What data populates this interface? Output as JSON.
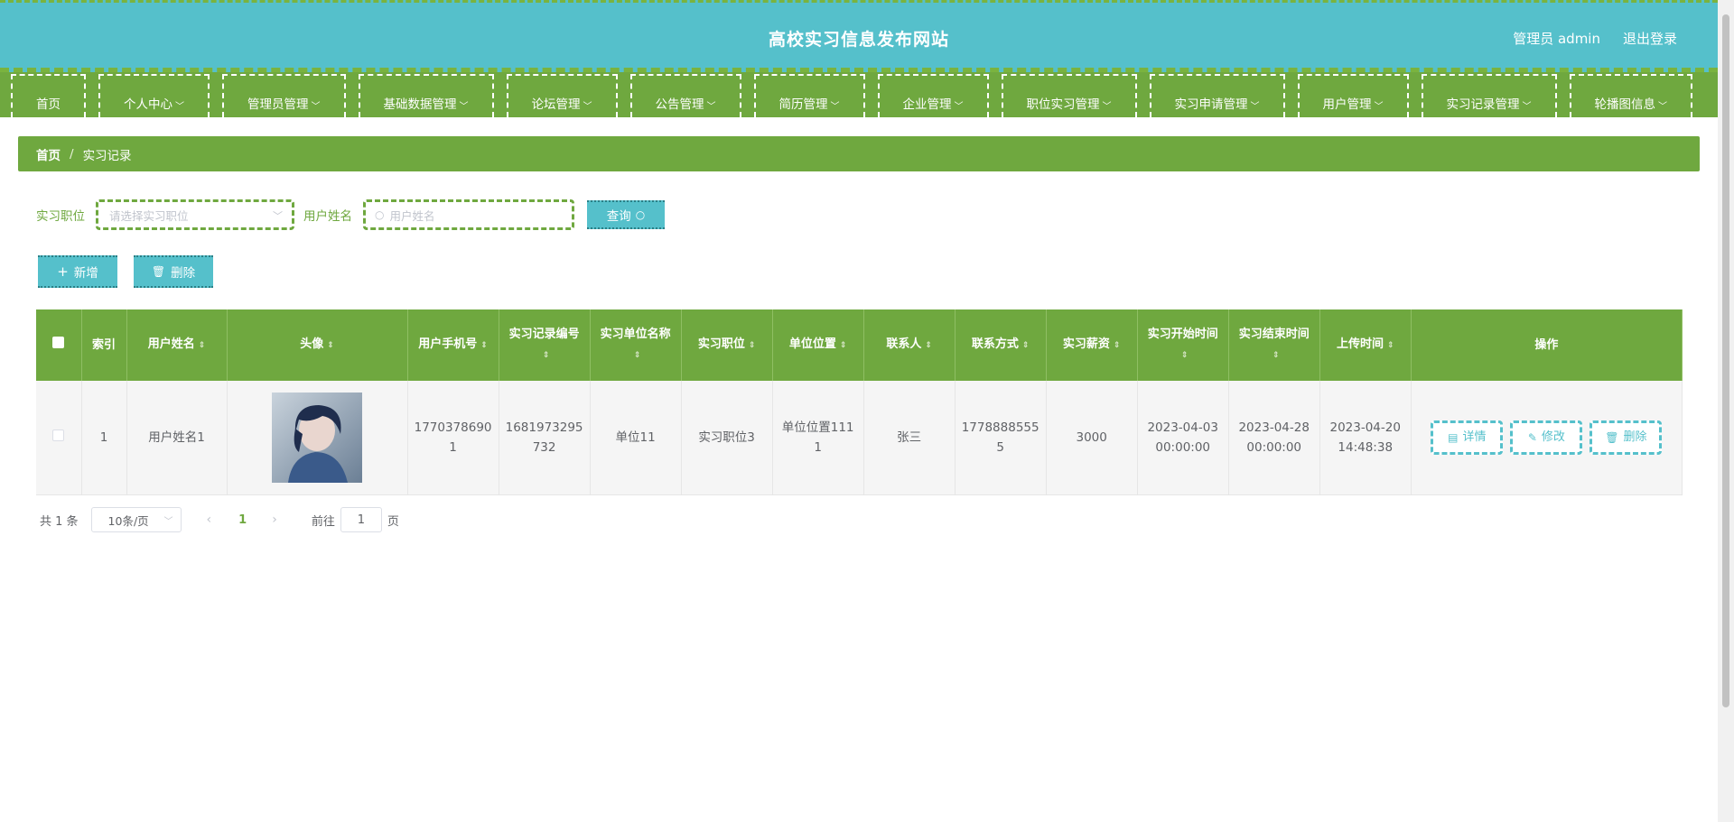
{
  "header": {
    "title": "高校实习信息发布网站",
    "user": "管理员 admin",
    "logout": "退出登录"
  },
  "nav": [
    {
      "label": "首页",
      "dropdown": false
    },
    {
      "label": "个人中心",
      "dropdown": true
    },
    {
      "label": "管理员管理",
      "dropdown": true
    },
    {
      "label": "基础数据管理",
      "dropdown": true
    },
    {
      "label": "论坛管理",
      "dropdown": true
    },
    {
      "label": "公告管理",
      "dropdown": true
    },
    {
      "label": "简历管理",
      "dropdown": true
    },
    {
      "label": "企业管理",
      "dropdown": true
    },
    {
      "label": "职位实习管理",
      "dropdown": true
    },
    {
      "label": "实习申请管理",
      "dropdown": true
    },
    {
      "label": "用户管理",
      "dropdown": true
    },
    {
      "label": "实习记录管理",
      "dropdown": true
    },
    {
      "label": "轮播图信息",
      "dropdown": true
    }
  ],
  "breadcrumb": {
    "home": "首页",
    "sep": "/",
    "current": "实习记录"
  },
  "search": {
    "position_label": "实习职位",
    "position_placeholder": "请选择实习职位",
    "username_label": "用户姓名",
    "username_placeholder": "用户姓名",
    "query_label": "查询"
  },
  "actions": {
    "add": "新增",
    "delete": "删除"
  },
  "table": {
    "columns": [
      {
        "label": "",
        "sortable": false
      },
      {
        "label": "索引",
        "sortable": false
      },
      {
        "label": "用户姓名",
        "sortable": true
      },
      {
        "label": "头像",
        "sortable": true
      },
      {
        "label": "用户手机号",
        "sortable": true
      },
      {
        "label": "实习记录编号",
        "sortable": true
      },
      {
        "label": "实习单位名称",
        "sortable": true
      },
      {
        "label": "实习职位",
        "sortable": true
      },
      {
        "label": "单位位置",
        "sortable": true
      },
      {
        "label": "联系人",
        "sortable": true
      },
      {
        "label": "联系方式",
        "sortable": true
      },
      {
        "label": "实习薪资",
        "sortable": true
      },
      {
        "label": "实习开始时间",
        "sortable": true
      },
      {
        "label": "实习结束时间",
        "sortable": true
      },
      {
        "label": "上传时间",
        "sortable": true
      },
      {
        "label": "操作",
        "sortable": false
      }
    ],
    "rows": [
      {
        "index": "1",
        "username": "用户姓名1",
        "phone": "17703786901",
        "record_no": "1681973295732",
        "company": "单位11",
        "position": "实习职位3",
        "location": "单位位置1111",
        "contact": "张三",
        "contact_phone": "17788885555",
        "salary": "3000",
        "start": "2023-04-03 00:00:00",
        "end": "2023-04-28 00:00:00",
        "uploaded": "2023-04-20 14:48:38"
      }
    ],
    "row_ops": {
      "detail": "详情",
      "edit": "修改",
      "delete": "删除"
    }
  },
  "pagination": {
    "total": "共 1 条",
    "page_size": "10条/页",
    "current_page": "1",
    "goto_label": "前往",
    "goto_value": "1",
    "goto_unit": "页"
  },
  "colors": {
    "header": "#55c0cb",
    "nav": "#6fa83f",
    "accent": "#55c0cb"
  }
}
